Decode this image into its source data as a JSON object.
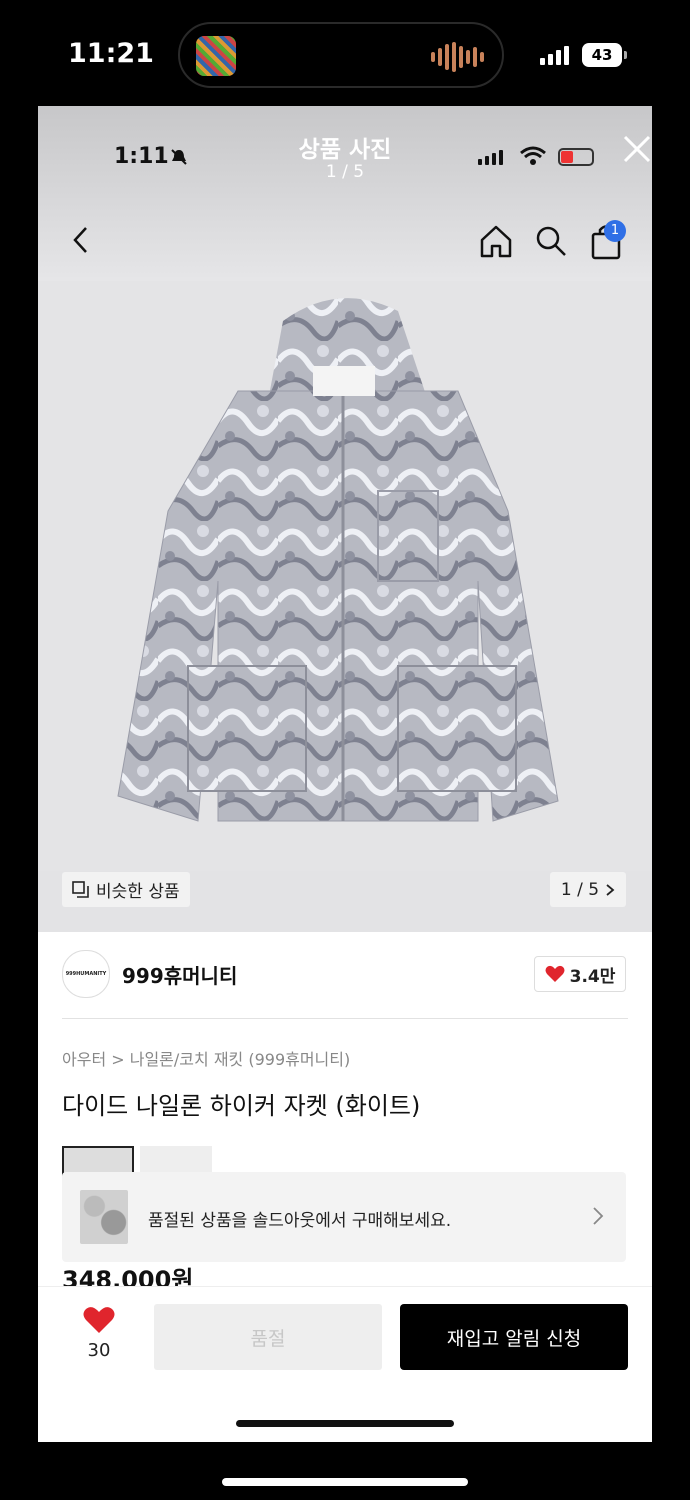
{
  "device": {
    "time": "11:21",
    "battery": "43"
  },
  "inner_status": {
    "time": "1:11"
  },
  "viewer": {
    "title": "상품 사진",
    "counter": "1 / 5"
  },
  "header": {
    "cart_count": "1"
  },
  "gallery": {
    "similar_label": "비슷한 상품",
    "pager": "1 / 5"
  },
  "brand": {
    "logo_text": "999HUMANITY",
    "name": "999휴머니티",
    "likes": "3.4만"
  },
  "product": {
    "breadcrumb": "아우터 > 나일론/코치 재킷 (999휴머니티)",
    "title": "다이드 나일론 하이커 자켓 (화이트)",
    "price": "348,000원"
  },
  "soldout_banner": {
    "text": "품절된 상품을 솔드아웃에서 구매해보세요."
  },
  "bottom": {
    "wish_count": "30",
    "soldout_label": "품절",
    "restock_label": "재입고 알림 신청"
  },
  "colors": {
    "heart": "#e0252d",
    "badge": "#2f6fe6",
    "primary_button": "#000000"
  }
}
